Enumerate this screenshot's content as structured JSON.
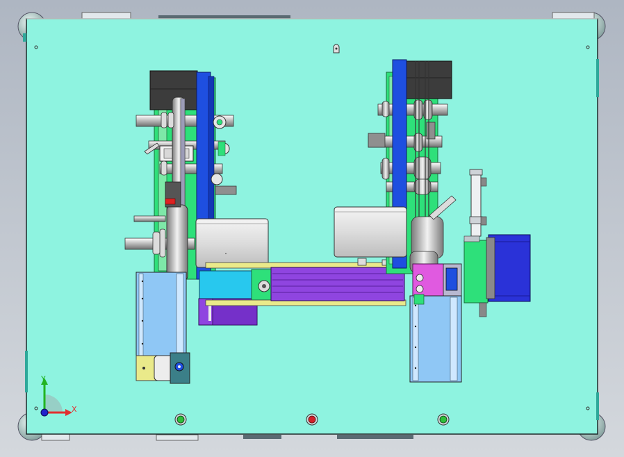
{
  "viewport": {
    "background_top": "#aeb6c2",
    "background_bottom": "#d4d8dd"
  },
  "colors": {
    "plate": "#8ef3e0",
    "belt_blue": "#1e4fe0",
    "motor_gray": "#e4e4e4",
    "dark_block": "#3c3c3c",
    "purple": "#8f45e0",
    "cyan": "#28c8ee",
    "magenta": "#e05ae0",
    "green": "#2ee07a",
    "rail_blue": "#8fc7f5",
    "yellow": "#eaea8a",
    "stepper_blue": "#2a32d8"
  },
  "triad": {
    "x_label": "X",
    "y_label": "Y",
    "x_color": "#e03030",
    "y_color": "#22b422",
    "z_color": "#2222cc"
  },
  "buttons": [
    {
      "name": "left-green-button",
      "color": "#2fbf3a"
    },
    {
      "name": "center-red-button",
      "color": "#d2202a"
    },
    {
      "name": "right-green-button",
      "color": "#2fbf3a"
    }
  ]
}
